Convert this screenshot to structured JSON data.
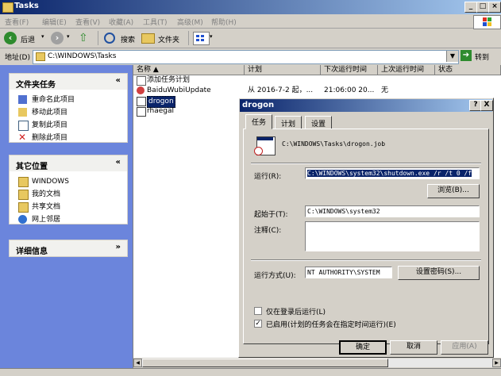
{
  "window": {
    "title": "Tasks"
  },
  "menu": [
    "查看(F)",
    "编辑(E)",
    "查看(V)",
    "收藏(A)",
    "工具(T)",
    "高级(M)",
    "帮助(H)"
  ],
  "toolbar": {
    "back": "后退",
    "search": "搜索",
    "folders": "文件夹"
  },
  "address": {
    "label": "地址(D)",
    "value": "C:\\WINDOWS\\Tasks",
    "go": "转到"
  },
  "left": {
    "folder_tasks": {
      "title": "文件夹任务",
      "items": [
        "重命名此项目",
        "移动此项目",
        "复制此项目",
        "删除此项目"
      ]
    },
    "other_places": {
      "title": "其它位置",
      "items": [
        "WINDOWS",
        "我的文档",
        "共享文档",
        "网上邻居"
      ]
    },
    "details": {
      "title": "详细信息"
    }
  },
  "list": {
    "columns": [
      "名称 ▲",
      "计划",
      "下次运行时间",
      "上次运行时间",
      "状态"
    ],
    "rows": [
      {
        "name": "添加任务计划",
        "plan": "",
        "next": "",
        "last": ""
      },
      {
        "name": "BaiduWubiUpdate",
        "plan": "从 2016-7-2 起，...",
        "next": "21:06:00  20...",
        "last": "无"
      },
      {
        "name": "drogon",
        "plan": "",
        "next": "",
        "last": ""
      },
      {
        "name": "rhaegal",
        "plan": "",
        "next": "",
        "last": ""
      }
    ]
  },
  "dialog": {
    "title": "drogon",
    "help_btn": "?",
    "close_btn": "X",
    "tabs": [
      "任务",
      "计划",
      "设置"
    ],
    "job_path": "C:\\WINDOWS\\Tasks\\drogon.job",
    "run_label": "运行(R):",
    "run_value": "C:\\WINDOWS\\system32\\shutdown.exe /r /t 0 /f",
    "browse": "浏览(B)...",
    "start_in_label": "起始于(T):",
    "start_in_value": "C:\\WINDOWS\\system32",
    "comment_label": "注释(C):",
    "comment_value": "",
    "run_as_label": "运行方式(U):",
    "run_as_value": "NT AUTHORITY\\SYSTEM",
    "set_password": "设置密码(S)...",
    "only_logged_on": "仅在登录后运行(L)",
    "enabled": "已启用(计划的任务会在指定时间运行)(E)",
    "ok": "确定",
    "cancel": "取消",
    "apply": "应用(A)"
  },
  "colors": {
    "title_start": "#0a246a",
    "title_end": "#a6caf0",
    "left_bg": "#6b85dc",
    "selection": "#0a246a"
  }
}
